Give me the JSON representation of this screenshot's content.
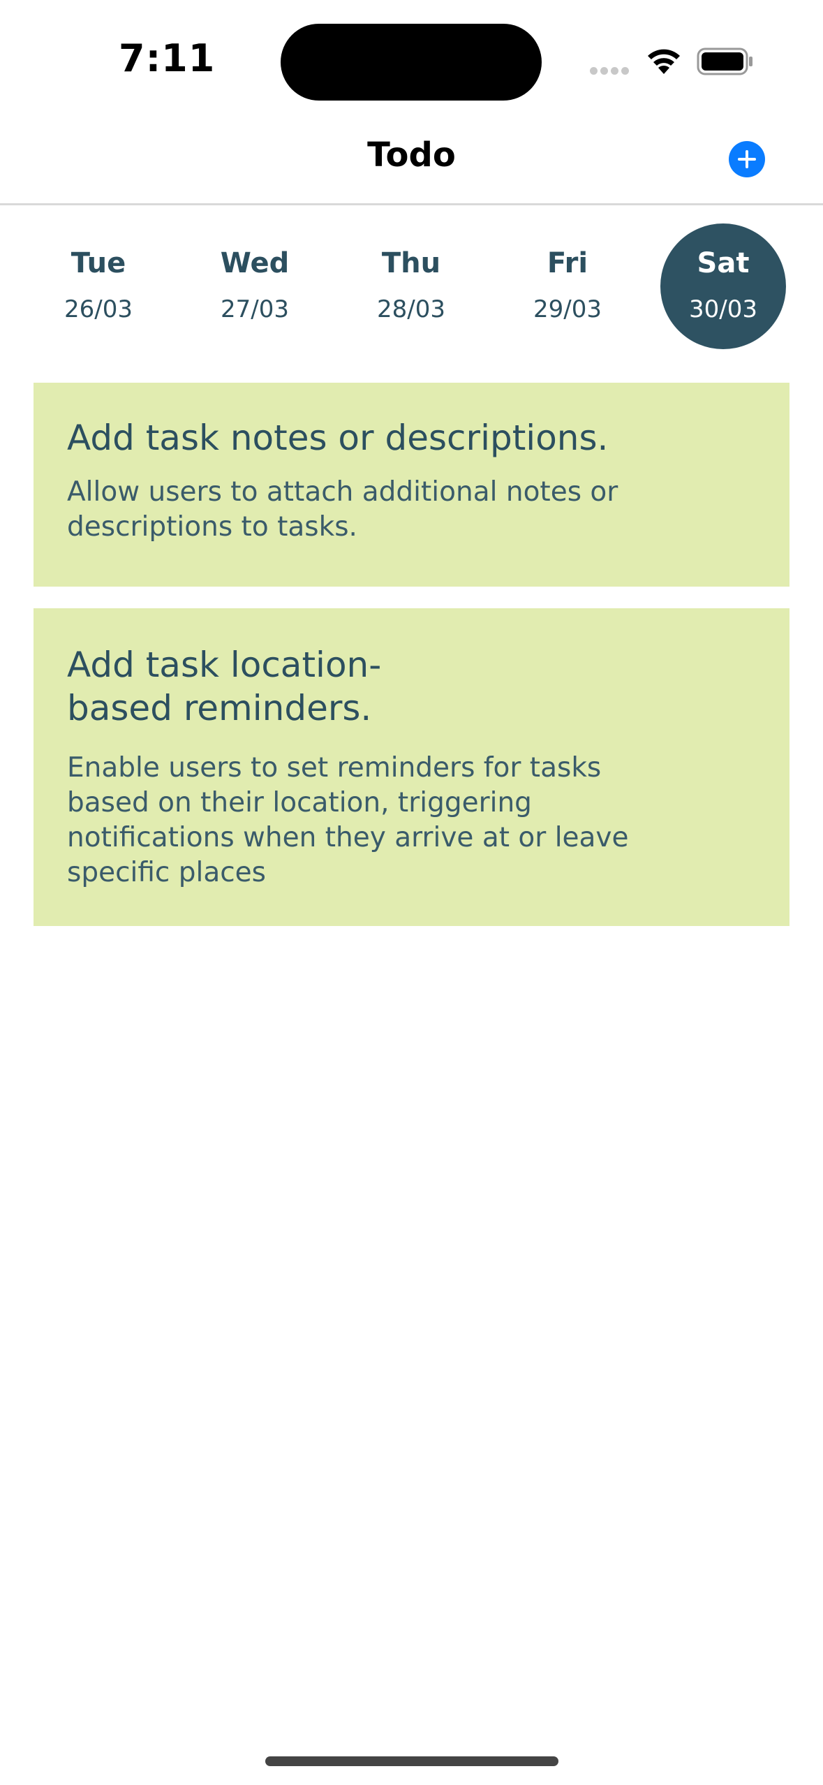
{
  "status_bar": {
    "time": "7:11"
  },
  "nav": {
    "title": "Todo",
    "add_icon": "plus-circle-icon",
    "accent_color": "#0a7cff"
  },
  "dates": [
    {
      "day": "Tue",
      "date": "26/03",
      "selected": false
    },
    {
      "day": "Wed",
      "date": "27/03",
      "selected": false
    },
    {
      "day": "Thu",
      "date": "28/03",
      "selected": false
    },
    {
      "day": "Fri",
      "date": "29/03",
      "selected": false
    },
    {
      "day": "Sat",
      "date": "30/03",
      "selected": true
    }
  ],
  "tasks": [
    {
      "title": "Add task notes or descriptions.",
      "description": "Allow users to attach additional notes or descriptions to tasks."
    },
    {
      "title": "Add task location-based reminders.",
      "description": "Enable users to set reminders for tasks based on their location, triggering notifications when they arrive at or leave specific places"
    }
  ],
  "colors": {
    "selected_date_bg": "#2e5262",
    "card_bg": "#e1ecb0",
    "text": "#2c4f5f"
  }
}
